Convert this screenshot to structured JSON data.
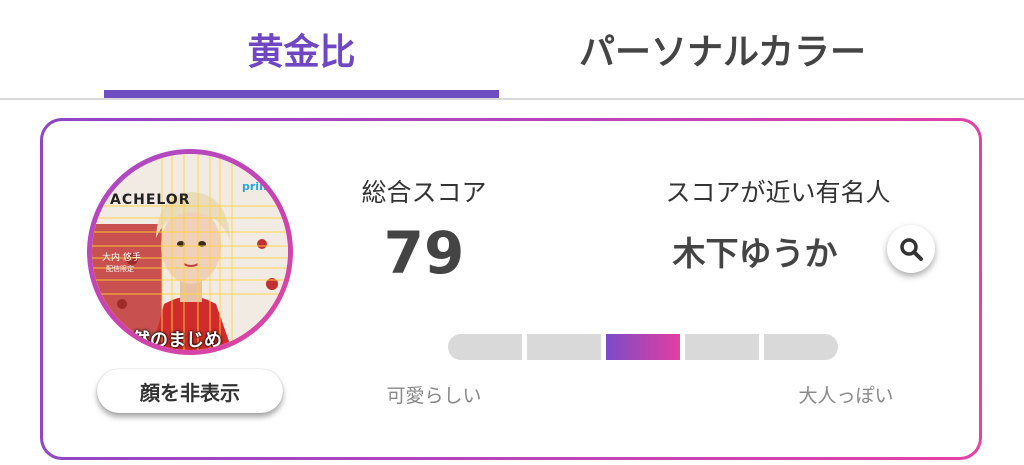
{
  "tabs": [
    {
      "label": "黄金比",
      "active": true
    },
    {
      "label": "パーソナルカラー",
      "active": false
    }
  ],
  "colors": {
    "accent": "#6e4cc2",
    "gradient_start": "#8d46c6",
    "gradient_end": "#e642a4",
    "scale_inactive": "#d9d9d9"
  },
  "result_card": {
    "avatar": {
      "photo_text": {
        "logo": "ACHELOR",
        "prime": "prime",
        "name": "大内 悠手",
        "sub": "配信限定",
        "caption": "然のまじめ"
      }
    },
    "hide_face_button": "顔を非表示",
    "score": {
      "label": "総合スコア",
      "value": "79"
    },
    "celebrity": {
      "label": "スコアが近い有名人",
      "name": "木下ゆうか",
      "search_icon": "search-icon"
    },
    "impression_scale": {
      "segments": 5,
      "active_index": 2,
      "left_label": "可愛らしい",
      "right_label": "大人っぽい"
    }
  }
}
